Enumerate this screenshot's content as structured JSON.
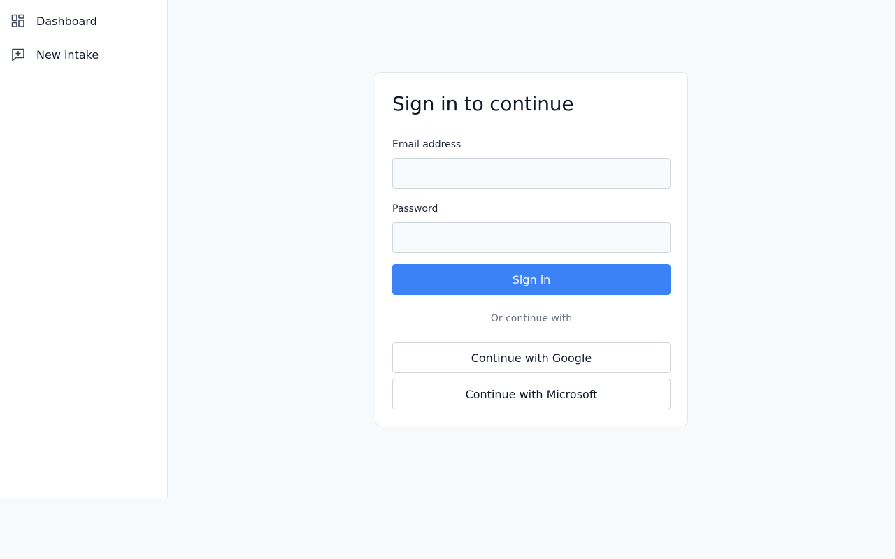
{
  "sidebar": {
    "items": [
      {
        "label": "Dashboard",
        "icon": "dashboard-icon"
      },
      {
        "label": "New intake",
        "icon": "message-plus-icon"
      }
    ]
  },
  "login": {
    "title": "Sign in to continue",
    "email_label": "Email address",
    "email_value": "",
    "email_placeholder": "",
    "password_label": "Password",
    "password_value": "",
    "password_placeholder": "",
    "submit_label": "Sign in",
    "divider_text": "Or continue with",
    "google_label": "Continue with Google",
    "microsoft_label": "Continue with Microsoft"
  },
  "colors": {
    "primary": "#3b82f6",
    "background": "#f8f9fb",
    "border": "#e5e7eb"
  }
}
